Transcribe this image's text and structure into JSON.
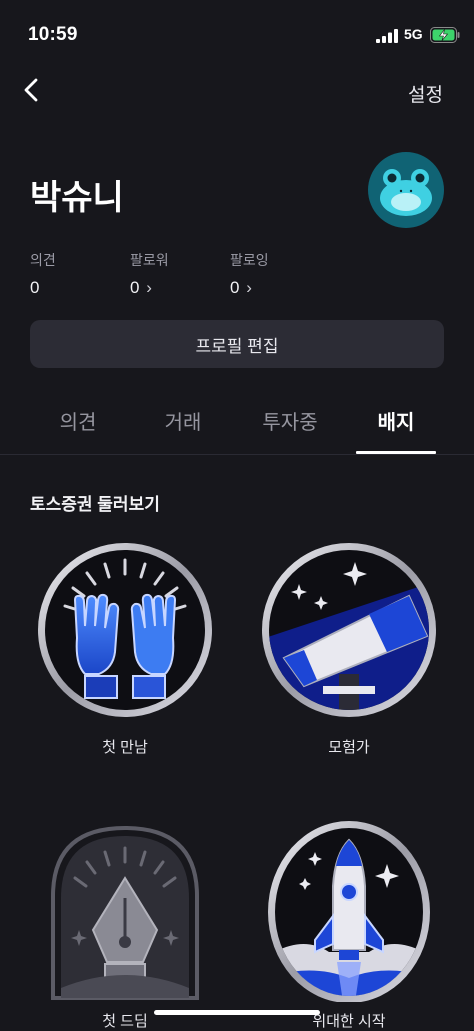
{
  "status_bar": {
    "time": "10:59",
    "network": "5G"
  },
  "nav": {
    "settings_label": "설정"
  },
  "profile": {
    "name": "박슈니"
  },
  "stats": [
    {
      "label": "의견",
      "value": "0"
    },
    {
      "label": "팔로워",
      "value": "0"
    },
    {
      "label": "팔로잉",
      "value": "0"
    }
  ],
  "edit_profile_label": "프로필 편집",
  "tabs": [
    {
      "label": "의견",
      "active": false
    },
    {
      "label": "거래",
      "active": false
    },
    {
      "label": "투자중",
      "active": false
    },
    {
      "label": "배지",
      "active": true
    }
  ],
  "section_title": "토스증권 둘러보기",
  "badges": [
    {
      "label": "첫 만남",
      "icon": "high-five-icon",
      "locked": false
    },
    {
      "label": "모험가",
      "icon": "telescope-icon",
      "locked": false
    },
    {
      "label": "첫 드딤",
      "icon": "pen-nib-icon",
      "locked": true
    },
    {
      "label": "위대한 시작",
      "icon": "rocket-icon",
      "locked": false
    }
  ],
  "colors": {
    "background": "#17171c",
    "button": "#2c2c35",
    "badge_blue": "#2a6cf0",
    "avatar_bg": "#106374"
  }
}
